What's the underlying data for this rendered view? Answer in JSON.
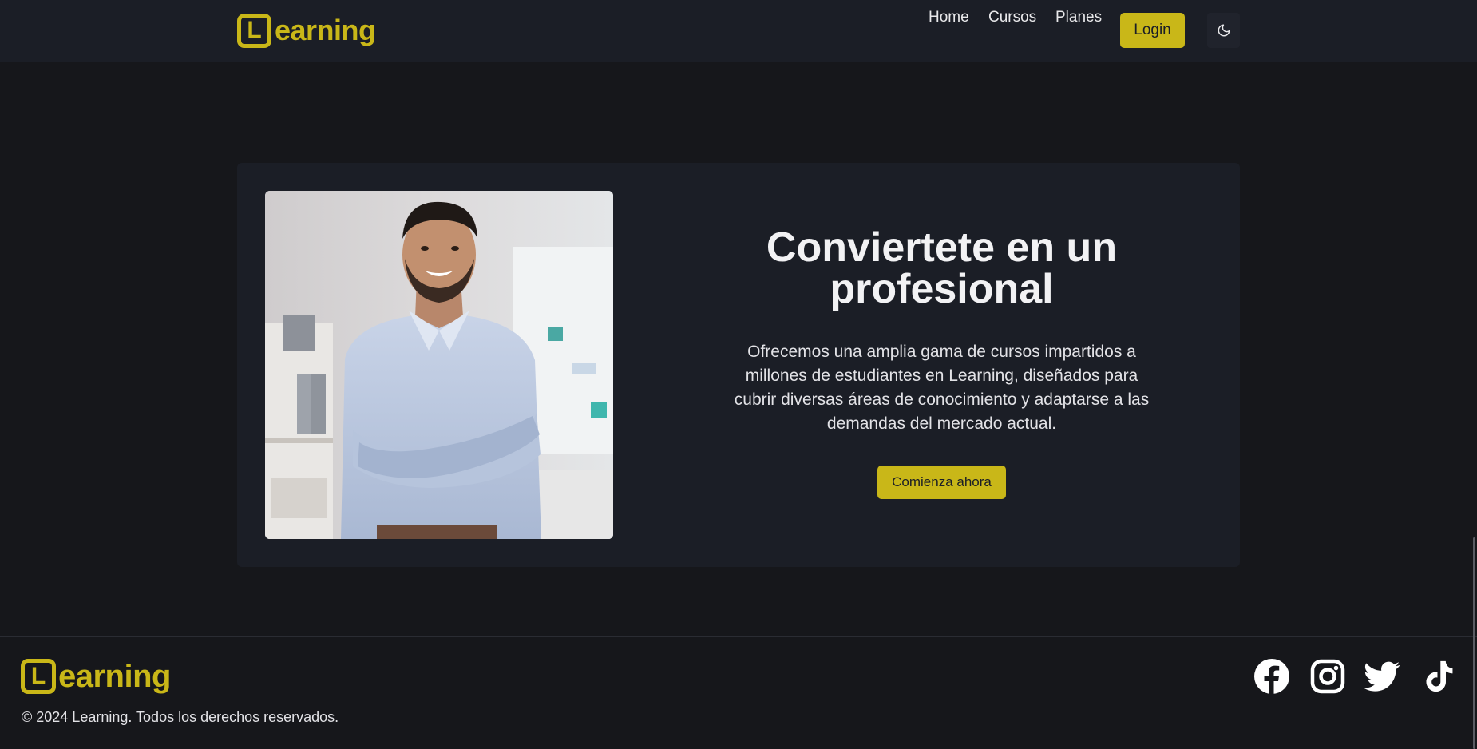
{
  "brand": {
    "logo_letter": "L",
    "logo_text": "earning",
    "accent_color": "#c9b718"
  },
  "nav": {
    "links": [
      "Home",
      "Cursos",
      "Planes"
    ],
    "login_label": "Login",
    "theme_toggle_icon": "moon-icon"
  },
  "hero": {
    "title": "Conviertete en un profesional",
    "description": "Ofrecemos una amplia gama de cursos impartidos a millones de estudiantes en Learning, diseñados para cubrir diversas áreas de conocimiento y adaptarse a las demandas del mercado actual.",
    "cta_label": "Comienza ahora",
    "image_subject": "smiling professional man with crossed arms in office"
  },
  "footer": {
    "copyright": "© 2024 Learning. Todos los derechos reservados.",
    "social_icons": [
      "facebook-icon",
      "instagram-icon",
      "twitter-icon",
      "tiktok-icon"
    ]
  },
  "colors": {
    "background": "#16171b",
    "surface": "#1b1e26",
    "text": "#e8e8ea"
  }
}
